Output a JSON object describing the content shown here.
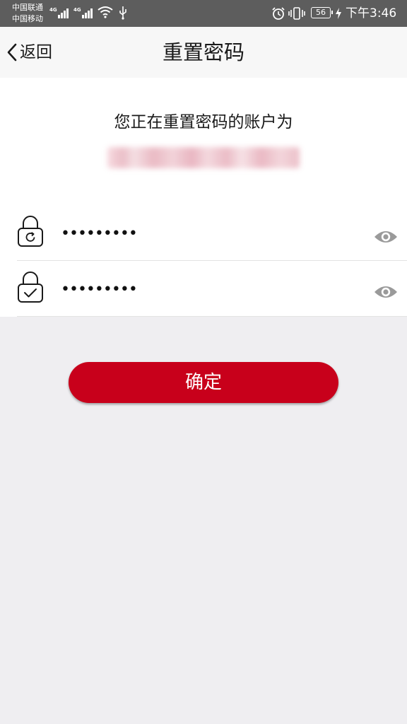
{
  "status_bar": {
    "carrier_1": "中国联通",
    "carrier_2": "中国移动",
    "network_1": "4G",
    "network_2": "4G",
    "battery_level": "56",
    "time": "下午3:46",
    "icons": [
      "signal-icon",
      "wifi-icon",
      "usb-icon",
      "alarm-icon",
      "vibrate-icon",
      "battery-icon",
      "charging-icon"
    ]
  },
  "nav": {
    "back_label": "返回",
    "title": "重置密码"
  },
  "account": {
    "caption": "您正在重置密码的账户为"
  },
  "fields": {
    "new_password": {
      "value": "•••••••••",
      "icon": "lock-refresh-icon",
      "toggle_icon": "eye-icon"
    },
    "confirm_password": {
      "value": "•••••••••",
      "icon": "lock-check-icon",
      "toggle_icon": "eye-icon"
    }
  },
  "confirm_button": {
    "label": "确定"
  },
  "colors": {
    "primary": "#c8001b",
    "status_bar": "#5d5d5d",
    "nav_bar": "#f7f7f7",
    "page_background": "#efeef1",
    "icon_gray": "#9a9a9a"
  }
}
